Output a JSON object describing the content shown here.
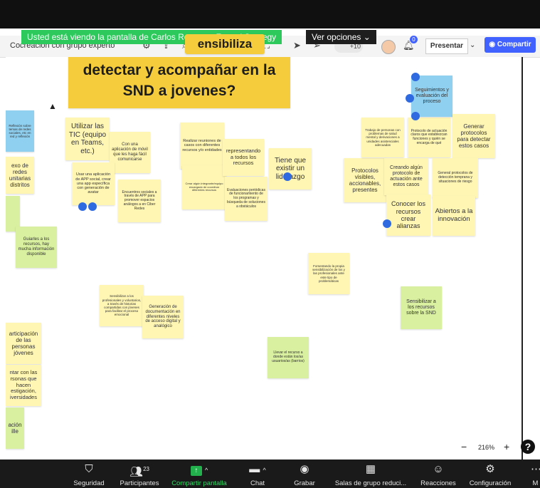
{
  "zoom_banner": {
    "text": "Usted está viendo la pantalla de Carlos Romero - Fractal Strategy",
    "options_label": "Ver opciones",
    "options_caret": "⌄"
  },
  "toolbar": {
    "board_title": "Cocreación con grupo experto",
    "collaborators_count": "+10",
    "notifications_count": "0",
    "present_label": "Presentar",
    "present_caret": "⌄",
    "share_label": "Compartir"
  },
  "board": {
    "title_partial": "ensibiliza",
    "title_note": "detectar y acompañar en la SND a jovenes?",
    "notes": [
      "Reflexión sobre temas de redes sociales, etc en red y reflexión",
      "exo de redes unitarias distritos",
      "",
      "Utilizar las TIC (equipo en Teams, etc.)",
      "Con una aplicación de móvil que les haga fácil comunicarse",
      "Usar una aplicación de APP social, crear una app específica con generación de avatar",
      "Encuentros sociales a través de APP para promover espacios análogos a en Ciber Redes",
      "Realizar reuniones de casos con diferentes recursos y/o entidades",
      "Crear algún integrante/equipo encargado de coordinar diferentes recursos",
      "representando a todos los recursos",
      "Evaluaciones periódicas de funcionamiento de los programas y búsqueda de soluciones a obstáculos",
      "Tiene que existir un liderazgo",
      "Protocolos visibles, accionables, presentes",
      "Trabajo de personas con problemas de salud mental y derivaciones a unidades asistenciales adecuadas",
      "Protocolo de actuación claros que establezcan funciones y quién se encarga de qué",
      "Seguimientos y evaluación del proceso",
      "Generar protocolos para detectar estos casos",
      "Creando algún protocolo de actuación ante estos casos",
      "General protocolos de detección temprana y situaciones de riesgo",
      "Conocer los recursos crear alianzas",
      "Abiertos a la innovación",
      "Guiarles a los recursos, hay mucha información disponible",
      "Fomentando la propia sensibilización de los y las profesionales ante este tipo de problemáticas",
      "Sensibilizar a los recursos sobre la SND",
      "Sensibilizar a los profesionales y voluntarios, a través de historias compartidas con jóvenes para facilitar el proceso emocional",
      "Generación de documentación en diferentes niveles de acceso digital y analógico",
      "articipación de las personas jóvenes",
      "ntar con las rsonas que hacen estigación, iversidades",
      "ación ille",
      "Llevar el recurso a donde están los/as usuarios/as (barrios)"
    ]
  },
  "zoom_control": {
    "minus": "−",
    "percent": "216%",
    "plus": "+",
    "help": "?"
  },
  "bottom_bar": {
    "items": [
      {
        "label": "Seguridad",
        "icon": "shield-icon"
      },
      {
        "label": "Participantes",
        "icon": "participants-icon",
        "count": "23"
      },
      {
        "label": "Compartir pantalla",
        "icon": "share-screen-icon"
      },
      {
        "label": "Chat",
        "icon": "chat-icon"
      },
      {
        "label": "Grabar",
        "icon": "record-icon"
      },
      {
        "label": "Salas de grupo reduci...",
        "icon": "breakout-rooms-icon"
      },
      {
        "label": "Reacciones",
        "icon": "reactions-icon"
      },
      {
        "label": "Configuración",
        "icon": "gear-icon"
      },
      {
        "label": "M",
        "icon": "more-icon"
      }
    ]
  },
  "colors": {
    "accent_green": "#2ec95c",
    "share_blue": "#4262ff",
    "note_yellow": "#fff6b4",
    "note_green": "#d8f0a0",
    "note_blue": "#8fd0f0",
    "title_note": "#f5cd3c"
  }
}
